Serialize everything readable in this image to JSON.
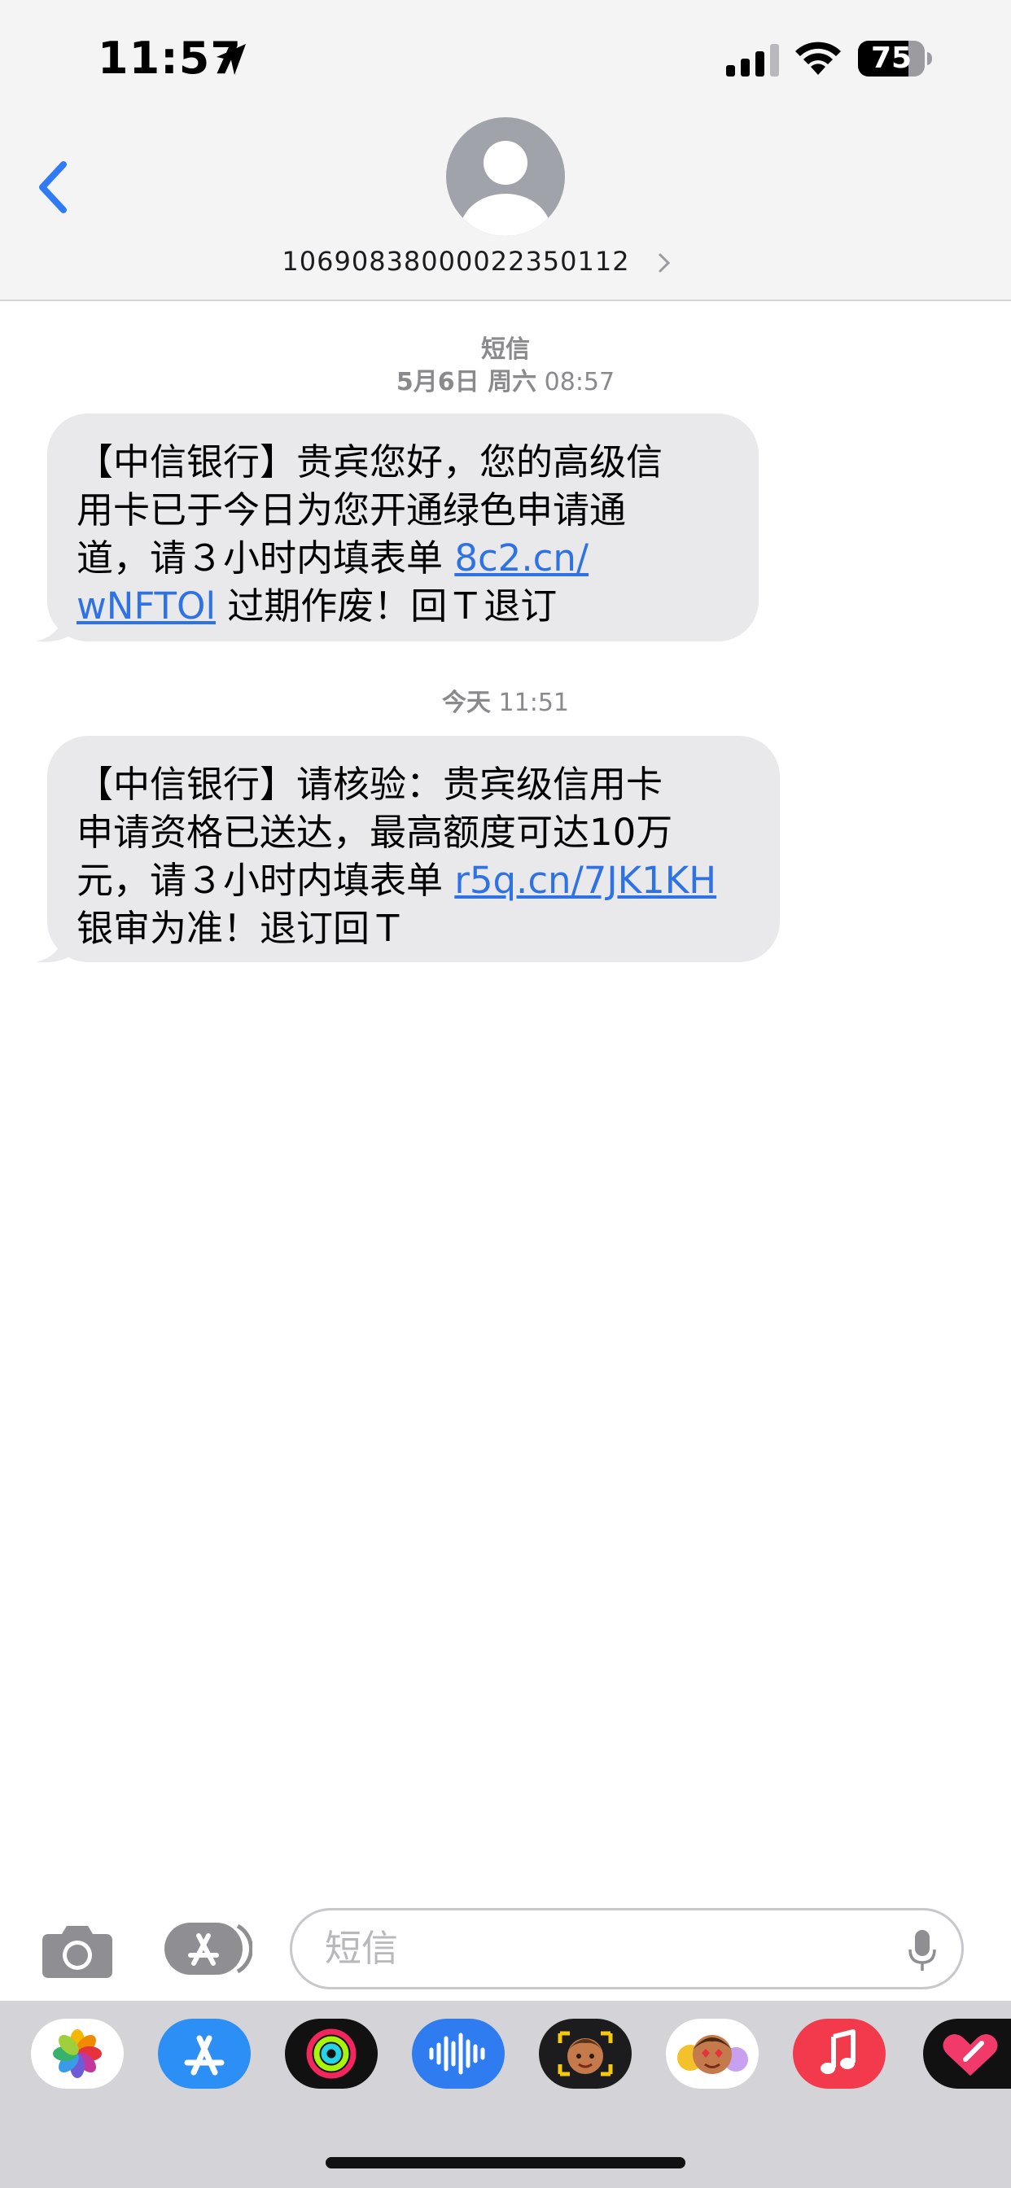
{
  "status_bar": {
    "time": "11:57",
    "battery": "75"
  },
  "header": {
    "contact_number": "1069083800002235​0112"
  },
  "conversation": {
    "service_label": "短信",
    "first_timestamp": {
      "date": "5月6日 周六",
      "time": "08:57"
    },
    "messages": [
      {
        "lines": [
          {
            "text": "【中信银行】贵宾您好，您的高级信"
          },
          {
            "text": "用卡已于今日为您开通绿色申请通"
          },
          {
            "text": "道，请３小时内填表单 ",
            "link": "8c2.cn/"
          },
          {
            "link": "wNFTOl",
            "text": " 过期作废！回Ｔ退订"
          }
        ]
      },
      {
        "lines": [
          {
            "text": "【中信银行】请核验：贵宾级信用卡"
          },
          {
            "text": "申请资格已送达，最高额度可达10万"
          },
          {
            "text": "元，请３小时内填表单 ",
            "link": "r5q.cn/7JK1KH"
          },
          {
            "text": "银审为准！退订回Ｔ"
          }
        ]
      }
    ],
    "second_timestamp": {
      "date": "今天",
      "time": "11:51"
    }
  },
  "input_bar": {
    "placeholder": "短信"
  },
  "app_drawer": {
    "apps": [
      "photos-app",
      "app-store-app",
      "activity-app",
      "audio-message-app",
      "memoji-app",
      "animoji-stickers-app",
      "music-app",
      "digital-touch-app"
    ]
  },
  "colors": {
    "link": "#2e72e6",
    "bubble": "#e9e9eb",
    "header_bg": "#f4f4f5",
    "back_chevron": "#2f7bf5",
    "drawer_bg": "#d4d4d8"
  }
}
